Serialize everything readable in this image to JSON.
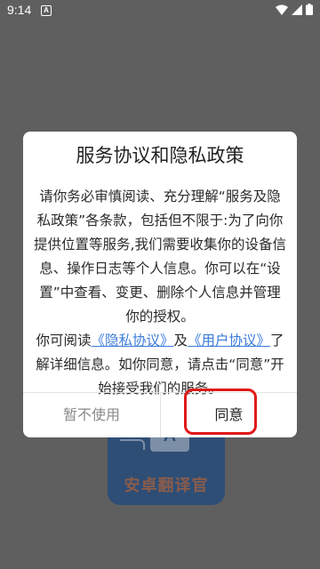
{
  "status_bar": {
    "time": "9:14",
    "notification_glyph": "A"
  },
  "background_app": {
    "logo_letter": "A",
    "brand_text": "安卓翻译官"
  },
  "dialog": {
    "title": "服务协议和隐私政策",
    "paragraph1": "请你务必审慎阅读、充分理解“服务及隐私政策”各条款，包括但不限于:为了向你提供位置等服务,我们需要收集你的设备信息、操作日志等个人信息。你可以在“设置”中查看、变更、删除个人信息并管理你的授权。",
    "paragraph2_pre": "你可阅读",
    "privacy_link": "《隐私协议》",
    "paragraph2_and": "及",
    "user_link": "《用户协议》",
    "paragraph2_post": "了解详细信息。如你同意，请点击“同意”开始接受我们的服务。",
    "decline_label": "暂不使用",
    "agree_label": "同意"
  },
  "colors": {
    "overlay": "#5f5f5f",
    "link": "#3b7bd8",
    "highlight": "#e01818"
  }
}
